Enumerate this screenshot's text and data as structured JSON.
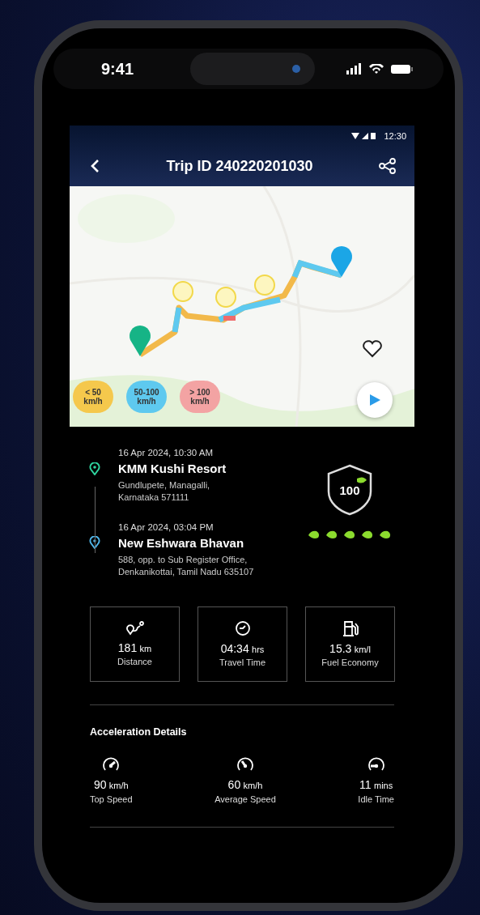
{
  "device_status": {
    "time": "9:41"
  },
  "app_status": {
    "time": "12:30"
  },
  "header": {
    "title": "Trip ID 240220201030"
  },
  "map": {
    "speed_legend": [
      {
        "label": "< 50",
        "unit": "km/h",
        "color": "#f5c84c"
      },
      {
        "label": "50-100",
        "unit": "km/h",
        "color": "#5ec9ef"
      },
      {
        "label": "> 100",
        "unit": "km/h",
        "color": "#f3a3a3"
      }
    ]
  },
  "trip": {
    "stops": [
      {
        "kind": "start",
        "datetime": "16 Apr 2024, 10:30 AM",
        "name": "KMM Kushi Resort",
        "address_lines": [
          "Gundlupete, Managalli,",
          "Karnataka 571111"
        ]
      },
      {
        "kind": "end",
        "datetime": "16 Apr 2024, 03:04 PM",
        "name": "New Eshwara Bhavan",
        "address_lines": [
          "588, opp. to Sub Register Office,",
          "Denkanikottai, Tamil Nadu 635107"
        ]
      }
    ],
    "score": "100",
    "stars": 5
  },
  "stats": [
    {
      "kind": "distance",
      "value": "181",
      "unit": "km",
      "label": "Distance"
    },
    {
      "kind": "time",
      "value": "04:34",
      "unit": "hrs",
      "label": "Travel Time"
    },
    {
      "kind": "fuel",
      "value": "15.3",
      "unit": "km/l",
      "label": "Fuel Economy"
    }
  ],
  "acceleration": {
    "title": "Acceleration Details",
    "items": [
      {
        "kind": "top",
        "value": "90",
        "unit": "km/h",
        "label": "Top Speed"
      },
      {
        "kind": "average",
        "value": "60",
        "unit": "km/h",
        "label": "Average Speed"
      },
      {
        "kind": "idle",
        "value": "11",
        "unit": "mins",
        "label": "Idle Time"
      }
    ]
  }
}
